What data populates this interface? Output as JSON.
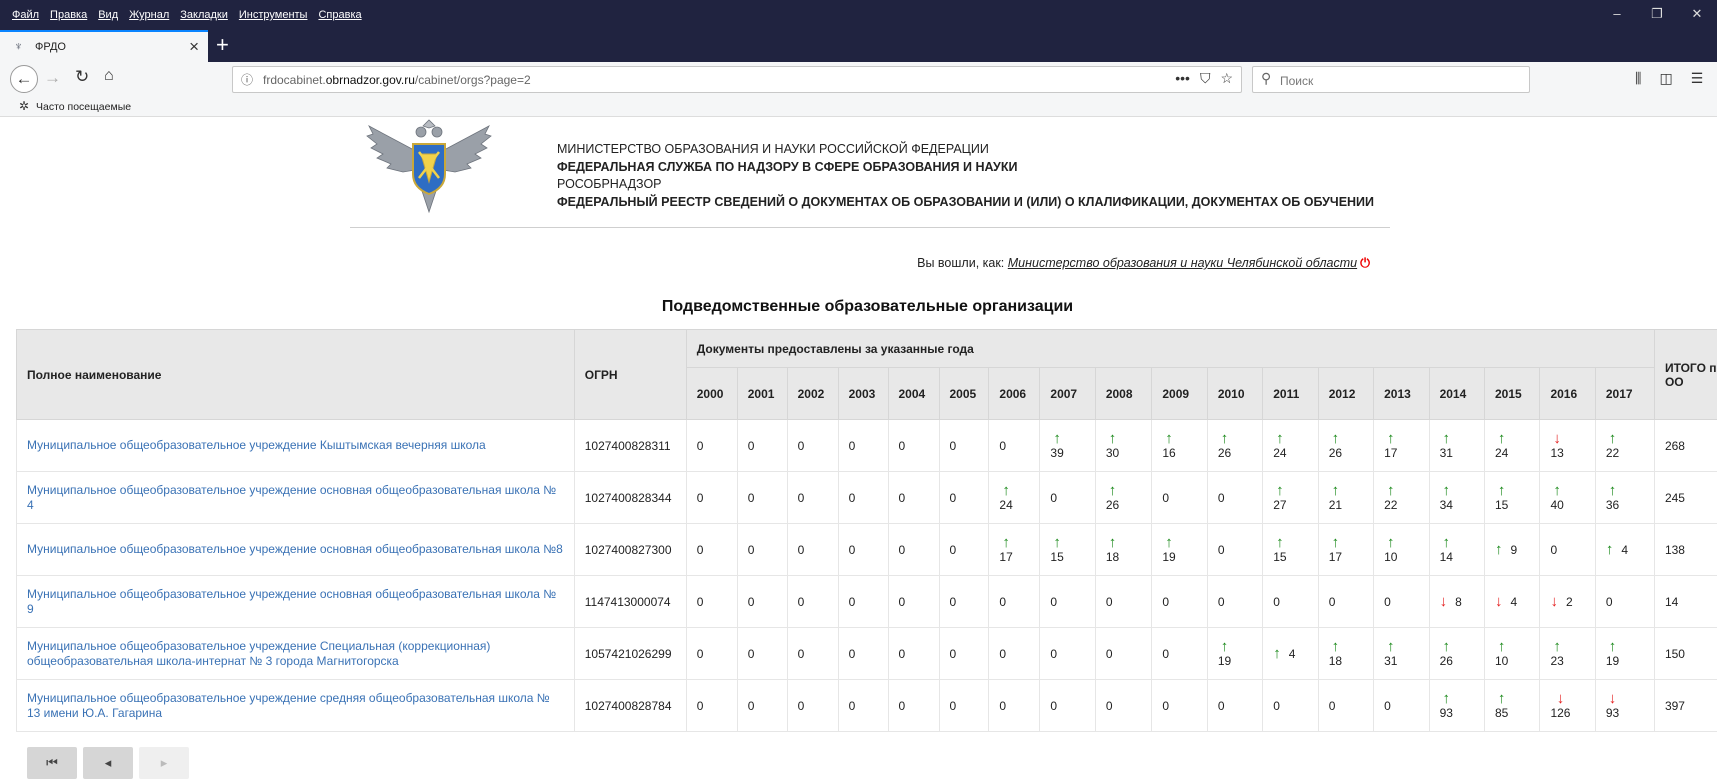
{
  "browser": {
    "menu": [
      "Файл",
      "Правка",
      "Вид",
      "Журнал",
      "Закладки",
      "Инструменты",
      "Справка"
    ],
    "tab_title": "ФРДО",
    "url_prefix": "frdocabinet.",
    "url_domain": "obrnadzor.gov.ru",
    "url_path": "/cabinet/orgs?page=2",
    "search_placeholder": "Поиск",
    "bookmark_label": "Часто посещаемые"
  },
  "header": {
    "line1": "МИНИСТЕРСТВО ОБРАЗОВАНИЯ И НАУКИ РОССИЙСКОЙ ФЕДЕРАЦИИ",
    "line2": "ФЕДЕРАЛЬНАЯ СЛУЖБА ПО НАДЗОРУ В СФЕРЕ ОБРАЗОВАНИЯ И НАУКИ",
    "line3": "РОСОБРНАДЗОР",
    "line4": "ФЕДЕРАЛЬНЫЙ РЕЕСТР СВЕДЕНИЙ О ДОКУМЕНТАХ ОБ ОБРАЗОВАНИИ И (ИЛИ) О КЛАЛИФИКАЦИИ, ДОКУМЕНТАХ ОБ ОБУЧЕНИИ",
    "login_prefix": "Вы вошли, как:",
    "login_user": "Министерство образования и науки Челябинской области"
  },
  "page_title": "Подведомственные образовательные организации",
  "table": {
    "col_name": "Полное наименование",
    "col_ogrn": "ОГРН",
    "col_docs": "Документы предоставлены за указанные года",
    "col_total": "ИТОГО по ОО",
    "years": [
      "2000",
      "2001",
      "2002",
      "2003",
      "2004",
      "2005",
      "2006",
      "2007",
      "2008",
      "2009",
      "2010",
      "2011",
      "2012",
      "2013",
      "2014",
      "2015",
      "2016",
      "2017"
    ],
    "rows": [
      {
        "name": "Муниципальное общеобразовательное учреждение Кыштымская вечерняя школа",
        "ogrn": "1027400828311",
        "values": [
          {
            "v": "0"
          },
          {
            "v": "0"
          },
          {
            "v": "0"
          },
          {
            "v": "0"
          },
          {
            "v": "0"
          },
          {
            "v": "0"
          },
          {
            "v": "0"
          },
          {
            "v": "39",
            "dir": "up",
            "layout": "stack"
          },
          {
            "v": "30",
            "dir": "up",
            "layout": "stack"
          },
          {
            "v": "16",
            "dir": "up",
            "layout": "stack"
          },
          {
            "v": "26",
            "dir": "up",
            "layout": "stack"
          },
          {
            "v": "24",
            "dir": "up",
            "layout": "stack"
          },
          {
            "v": "26",
            "dir": "up",
            "layout": "stack"
          },
          {
            "v": "17",
            "dir": "up",
            "layout": "stack"
          },
          {
            "v": "31",
            "dir": "up",
            "layout": "stack"
          },
          {
            "v": "24",
            "dir": "up",
            "layout": "stack"
          },
          {
            "v": "13",
            "dir": "down",
            "layout": "stack"
          },
          {
            "v": "22",
            "dir": "up",
            "layout": "stack"
          }
        ],
        "total": "268"
      },
      {
        "name": "Муниципальное общеобразовательное учреждение основная общеобразовательная школа № 4",
        "ogrn": "1027400828344",
        "values": [
          {
            "v": "0"
          },
          {
            "v": "0"
          },
          {
            "v": "0"
          },
          {
            "v": "0"
          },
          {
            "v": "0"
          },
          {
            "v": "0"
          },
          {
            "v": "24",
            "dir": "up",
            "layout": "stack"
          },
          {
            "v": "0"
          },
          {
            "v": "26",
            "dir": "up",
            "layout": "stack"
          },
          {
            "v": "0"
          },
          {
            "v": "0"
          },
          {
            "v": "27",
            "dir": "up",
            "layout": "stack"
          },
          {
            "v": "21",
            "dir": "up",
            "layout": "stack"
          },
          {
            "v": "22",
            "dir": "up",
            "layout": "stack"
          },
          {
            "v": "34",
            "dir": "up",
            "layout": "stack"
          },
          {
            "v": "15",
            "dir": "up",
            "layout": "stack"
          },
          {
            "v": "40",
            "dir": "up",
            "layout": "stack"
          },
          {
            "v": "36",
            "dir": "up",
            "layout": "stack"
          }
        ],
        "total": "245"
      },
      {
        "name": "Муниципальное общеобразовательное учреждение основная общеобразовательная школа №8",
        "ogrn": "1027400827300",
        "values": [
          {
            "v": "0"
          },
          {
            "v": "0"
          },
          {
            "v": "0"
          },
          {
            "v": "0"
          },
          {
            "v": "0"
          },
          {
            "v": "0"
          },
          {
            "v": "17",
            "dir": "up",
            "layout": "stack"
          },
          {
            "v": "15",
            "dir": "up",
            "layout": "stack"
          },
          {
            "v": "18",
            "dir": "up",
            "layout": "stack"
          },
          {
            "v": "19",
            "dir": "up",
            "layout": "stack"
          },
          {
            "v": "0"
          },
          {
            "v": "15",
            "dir": "up",
            "layout": "stack"
          },
          {
            "v": "17",
            "dir": "up",
            "layout": "stack"
          },
          {
            "v": "10",
            "dir": "up",
            "layout": "stack"
          },
          {
            "v": "14",
            "dir": "up",
            "layout": "stack"
          },
          {
            "v": "9",
            "dir": "up",
            "layout": "inline"
          },
          {
            "v": "0"
          },
          {
            "v": "4",
            "dir": "up",
            "layout": "inline"
          }
        ],
        "total": "138"
      },
      {
        "name": "Муниципальное общеобразовательное учреждение основная общеобразовательная школа № 9",
        "ogrn": "1147413000074",
        "values": [
          {
            "v": "0"
          },
          {
            "v": "0"
          },
          {
            "v": "0"
          },
          {
            "v": "0"
          },
          {
            "v": "0"
          },
          {
            "v": "0"
          },
          {
            "v": "0"
          },
          {
            "v": "0"
          },
          {
            "v": "0"
          },
          {
            "v": "0"
          },
          {
            "v": "0"
          },
          {
            "v": "0"
          },
          {
            "v": "0"
          },
          {
            "v": "0"
          },
          {
            "v": "8",
            "dir": "down",
            "layout": "inline"
          },
          {
            "v": "4",
            "dir": "down",
            "layout": "inline"
          },
          {
            "v": "2",
            "dir": "down",
            "layout": "inline"
          },
          {
            "v": "0"
          }
        ],
        "total": "14"
      },
      {
        "name": "Муниципальное общеобразовательное учреждение Специальная (коррекционная) общеобразовательная школа-интернат № 3 города Магнитогорска",
        "ogrn": "1057421026299",
        "values": [
          {
            "v": "0"
          },
          {
            "v": "0"
          },
          {
            "v": "0"
          },
          {
            "v": "0"
          },
          {
            "v": "0"
          },
          {
            "v": "0"
          },
          {
            "v": "0"
          },
          {
            "v": "0"
          },
          {
            "v": "0"
          },
          {
            "v": "0"
          },
          {
            "v": "19",
            "dir": "up",
            "layout": "stack"
          },
          {
            "v": "4",
            "dir": "up",
            "layout": "inline"
          },
          {
            "v": "18",
            "dir": "up",
            "layout": "stack"
          },
          {
            "v": "31",
            "dir": "up",
            "layout": "stack"
          },
          {
            "v": "26",
            "dir": "up",
            "layout": "stack"
          },
          {
            "v": "10",
            "dir": "up",
            "layout": "stack"
          },
          {
            "v": "23",
            "dir": "up",
            "layout": "stack"
          },
          {
            "v": "19",
            "dir": "up",
            "layout": "stack"
          }
        ],
        "total": "150"
      },
      {
        "name": "Муниципальное общеобразовательное учреждение средняя общеобразовательная школа № 13 имени Ю.А. Гагарина",
        "ogrn": "1027400828784",
        "values": [
          {
            "v": "0"
          },
          {
            "v": "0"
          },
          {
            "v": "0"
          },
          {
            "v": "0"
          },
          {
            "v": "0"
          },
          {
            "v": "0"
          },
          {
            "v": "0"
          },
          {
            "v": "0"
          },
          {
            "v": "0"
          },
          {
            "v": "0"
          },
          {
            "v": "0"
          },
          {
            "v": "0"
          },
          {
            "v": "0"
          },
          {
            "v": "0"
          },
          {
            "v": "93",
            "dir": "up",
            "layout": "stack"
          },
          {
            "v": "85",
            "dir": "up",
            "layout": "stack"
          },
          {
            "v": "126",
            "dir": "down",
            "layout": "stack"
          },
          {
            "v": "93",
            "dir": "down",
            "layout": "stack"
          }
        ],
        "total": "397"
      }
    ]
  },
  "pager": {
    "first": "⏮",
    "prev": "◂",
    "next": "▸"
  },
  "colors": {
    "link": "#3a72b5",
    "up": "#1c8a1c",
    "down": "#e42020",
    "chrome": "#202340"
  }
}
